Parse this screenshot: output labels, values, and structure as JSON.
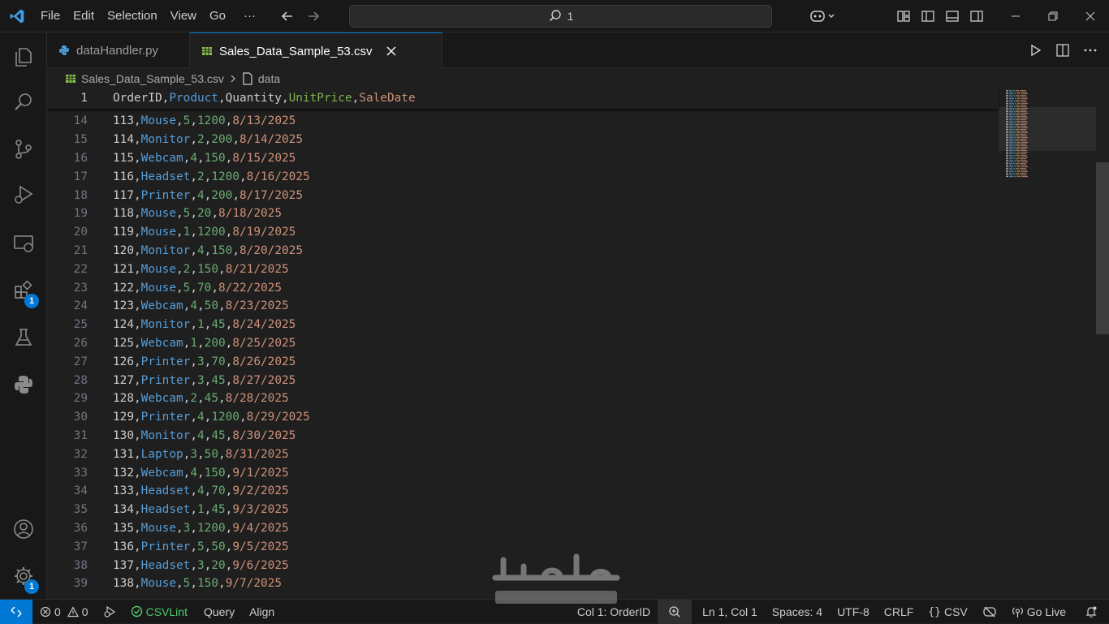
{
  "menu": [
    "File",
    "Edit",
    "Selection",
    "View",
    "Go",
    "···"
  ],
  "search": {
    "text": "1"
  },
  "tabs": [
    {
      "label": "dataHandler.py"
    },
    {
      "label": "Sales_Data_Sample_53.csv"
    }
  ],
  "breadcrumb": {
    "file": "Sales_Data_Sample_53.csv",
    "symbol": "data"
  },
  "activity_badges": {
    "extensions": "1",
    "settings": "1"
  },
  "header_line": {
    "number": "1",
    "fields": [
      "OrderID",
      "Product",
      "Quantity",
      "UnitPrice",
      "SaleDate"
    ]
  },
  "rows": [
    {
      "n": "14",
      "f": [
        "113",
        "Mouse",
        "5",
        "1200",
        "8/13/2025"
      ]
    },
    {
      "n": "15",
      "f": [
        "114",
        "Monitor",
        "2",
        "200",
        "8/14/2025"
      ]
    },
    {
      "n": "16",
      "f": [
        "115",
        "Webcam",
        "4",
        "150",
        "8/15/2025"
      ]
    },
    {
      "n": "17",
      "f": [
        "116",
        "Headset",
        "2",
        "1200",
        "8/16/2025"
      ]
    },
    {
      "n": "18",
      "f": [
        "117",
        "Printer",
        "4",
        "200",
        "8/17/2025"
      ]
    },
    {
      "n": "19",
      "f": [
        "118",
        "Mouse",
        "5",
        "20",
        "8/18/2025"
      ]
    },
    {
      "n": "20",
      "f": [
        "119",
        "Mouse",
        "1",
        "1200",
        "8/19/2025"
      ]
    },
    {
      "n": "21",
      "f": [
        "120",
        "Monitor",
        "4",
        "150",
        "8/20/2025"
      ]
    },
    {
      "n": "22",
      "f": [
        "121",
        "Mouse",
        "2",
        "150",
        "8/21/2025"
      ]
    },
    {
      "n": "23",
      "f": [
        "122",
        "Mouse",
        "5",
        "70",
        "8/22/2025"
      ]
    },
    {
      "n": "24",
      "f": [
        "123",
        "Webcam",
        "4",
        "50",
        "8/23/2025"
      ]
    },
    {
      "n": "25",
      "f": [
        "124",
        "Monitor",
        "1",
        "45",
        "8/24/2025"
      ]
    },
    {
      "n": "26",
      "f": [
        "125",
        "Webcam",
        "1",
        "200",
        "8/25/2025"
      ]
    },
    {
      "n": "27",
      "f": [
        "126",
        "Printer",
        "3",
        "70",
        "8/26/2025"
      ]
    },
    {
      "n": "28",
      "f": [
        "127",
        "Printer",
        "3",
        "45",
        "8/27/2025"
      ]
    },
    {
      "n": "29",
      "f": [
        "128",
        "Webcam",
        "2",
        "45",
        "8/28/2025"
      ]
    },
    {
      "n": "30",
      "f": [
        "129",
        "Printer",
        "4",
        "1200",
        "8/29/2025"
      ]
    },
    {
      "n": "31",
      "f": [
        "130",
        "Monitor",
        "4",
        "45",
        "8/30/2025"
      ]
    },
    {
      "n": "32",
      "f": [
        "131",
        "Laptop",
        "3",
        "50",
        "8/31/2025"
      ]
    },
    {
      "n": "33",
      "f": [
        "132",
        "Webcam",
        "4",
        "150",
        "9/1/2025"
      ]
    },
    {
      "n": "34",
      "f": [
        "133",
        "Headset",
        "4",
        "70",
        "9/2/2025"
      ]
    },
    {
      "n": "35",
      "f": [
        "134",
        "Headset",
        "1",
        "45",
        "9/3/2025"
      ]
    },
    {
      "n": "36",
      "f": [
        "135",
        "Mouse",
        "3",
        "1200",
        "9/4/2025"
      ]
    },
    {
      "n": "37",
      "f": [
        "136",
        "Printer",
        "5",
        "50",
        "9/5/2025"
      ]
    },
    {
      "n": "38",
      "f": [
        "137",
        "Headset",
        "3",
        "20",
        "9/6/2025"
      ]
    },
    {
      "n": "39",
      "f": [
        "138",
        "Mouse",
        "5",
        "150",
        "9/7/2025"
      ]
    }
  ],
  "status": {
    "errors": "0",
    "warnings": "0",
    "csvlint": "CSVLint",
    "query": "Query",
    "align": "Align",
    "column": "Col 1: OrderID",
    "position": "Ln 1, Col 1",
    "spaces": "Spaces: 4",
    "encoding": "UTF-8",
    "eol": "CRLF",
    "language": "CSV",
    "golive": "Go Live"
  },
  "watermark": {
    "arabic": "مستقل",
    "latin": "mostaql.com"
  },
  "colors": {
    "accent": "#0078d4",
    "field_default": "#cccccc",
    "field_blue": "#569cd6",
    "field_green": "#6aab73",
    "field_orange": "#ce9178"
  }
}
